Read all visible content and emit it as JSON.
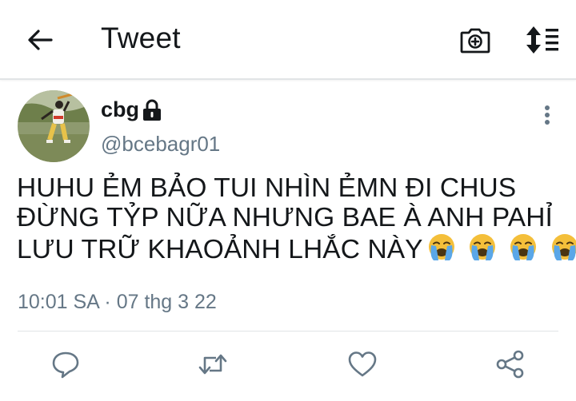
{
  "header": {
    "title": "Tweet",
    "back_icon": "arrow-left-icon",
    "camera_icon": "camera-plus-icon",
    "sort_icon": "sort-lines-icon"
  },
  "tweet": {
    "author": {
      "display_name": "cbg",
      "handle": "@bcebagr01",
      "protected_icon": "lock-icon",
      "avatar": "avatar"
    },
    "text_lines": [
      "HUHU ẺM BẢO TUI NHÌN ẺMN ĐI CHUS",
      "ĐỪNG TỶP NỮA NHƯNG BAE À ANH PAHỈ",
      "LƯU TRỮ KHAOẢNH LHẮC NÀY"
    ],
    "emojis": [
      "😭",
      "😭",
      "😭",
      "😭"
    ],
    "timestamp": "10:01 SA · 07 thg 3 22",
    "more_icon": "more-vertical-icon"
  },
  "actions": [
    {
      "name": "reply",
      "icon": "reply-icon"
    },
    {
      "name": "retweet",
      "icon": "retweet-icon"
    },
    {
      "name": "like",
      "icon": "heart-icon"
    },
    {
      "name": "share",
      "icon": "share-icon"
    }
  ],
  "colors": {
    "text": "#14171a",
    "secondary": "#657786",
    "divider": "#e1e4e6",
    "icon": "#657786",
    "emoji_face": "#f4bf3a",
    "emoji_tears": "#5aa7e8"
  }
}
